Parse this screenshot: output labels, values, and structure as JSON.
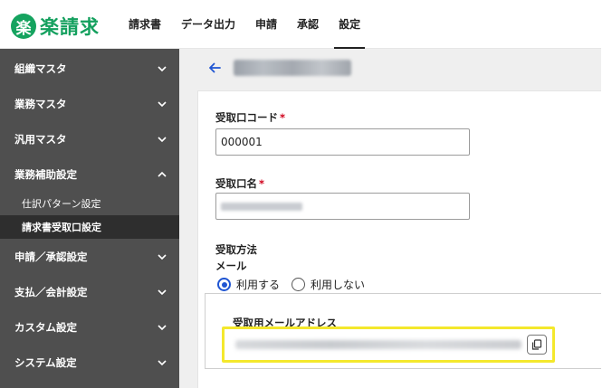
{
  "app": {
    "logo_mark": "楽",
    "logo_text": "楽請求"
  },
  "nav": [
    {
      "label": "請求書",
      "active": false
    },
    {
      "label": "データ出力",
      "active": false
    },
    {
      "label": "申請",
      "active": false
    },
    {
      "label": "承認",
      "active": false
    },
    {
      "label": "設定",
      "active": true
    }
  ],
  "sidebar": {
    "items": [
      {
        "label": "組織マスタ",
        "expanded": false
      },
      {
        "label": "業務マスタ",
        "expanded": false
      },
      {
        "label": "汎用マスタ",
        "expanded": false
      },
      {
        "label": "業務補助設定",
        "expanded": true
      },
      {
        "label": "申請／承認設定",
        "expanded": false
      },
      {
        "label": "支払／会計設定",
        "expanded": false
      },
      {
        "label": "カスタム設定",
        "expanded": false
      },
      {
        "label": "システム設定",
        "expanded": false
      }
    ],
    "subitems": [
      {
        "label": "仕訳パターン設定",
        "active": false
      },
      {
        "label": "請求書受取口設定",
        "active": true
      }
    ]
  },
  "page": {
    "back_icon": "arrow-left-icon"
  },
  "form": {
    "code_label": "受取口コード",
    "code_value": "000001",
    "name_label": "受取口名",
    "required_mark": "*",
    "method_label": "受取方法",
    "mail_label": "メール",
    "radio_use": "利用する",
    "radio_not_use": "利用しない",
    "email_label": "受取用メールアドレス"
  },
  "colors": {
    "brand": "#15a35f",
    "sidebar": "#4f4f4f",
    "accent": "#1f55d2",
    "highlight": "#f4e82c",
    "required": "#d0021b"
  }
}
